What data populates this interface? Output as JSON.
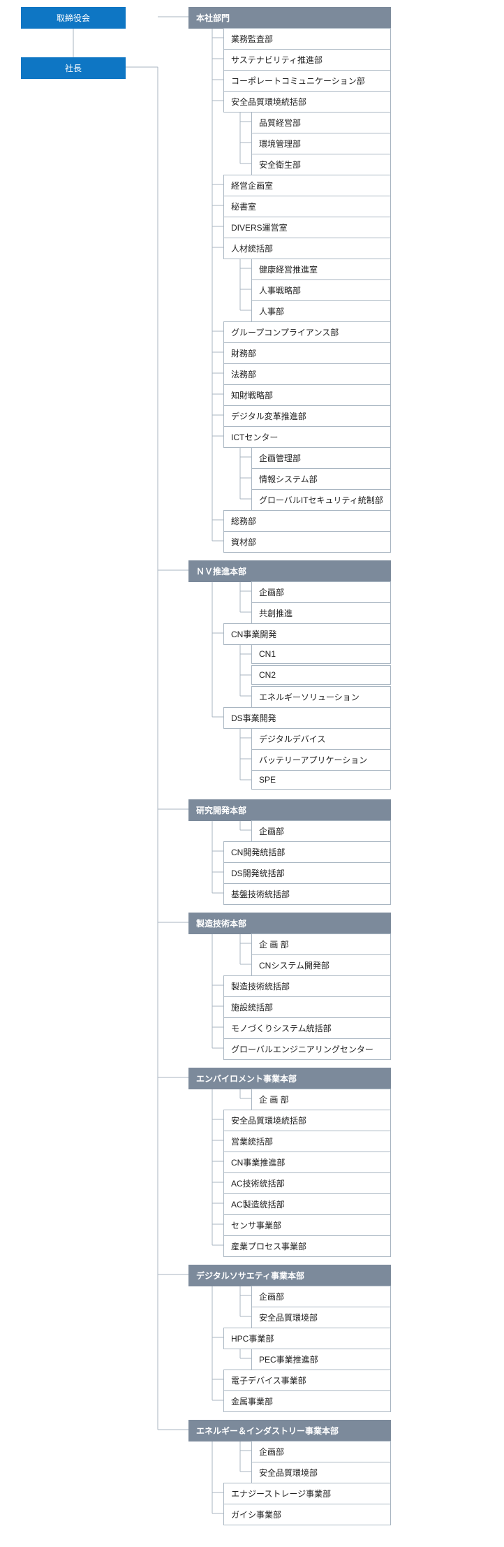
{
  "roots": {
    "board": "取締役会",
    "president": "社長"
  },
  "divisions": [
    {
      "name": "本社部門",
      "items": [
        {
          "label": "業務監査部"
        },
        {
          "label": "サステナビリティ推進部"
        },
        {
          "label": "コーポレートコミュニケーション部"
        },
        {
          "label": "安全品質環境統括部",
          "children": [
            "品質経営部",
            "環境管理部",
            "安全衛生部"
          ]
        },
        {
          "label": "経営企画室"
        },
        {
          "label": "秘書室"
        },
        {
          "label": "DIVERS運営室"
        },
        {
          "label": "人材統括部",
          "children": [
            "健康経営推進室",
            "人事戦略部",
            "人事部"
          ]
        },
        {
          "label": "グループコンプライアンス部"
        },
        {
          "label": "財務部"
        },
        {
          "label": "法務部"
        },
        {
          "label": "知財戦略部"
        },
        {
          "label": "デジタル変革推進部"
        },
        {
          "label": "ICTセンター",
          "children": [
            "企画管理部",
            "情報システム部",
            "グローバルITセキュリティ統制部"
          ]
        },
        {
          "label": "総務部"
        },
        {
          "label": "資材部"
        }
      ]
    },
    {
      "name": "ＮＶ推進本部",
      "items": [
        {
          "label": null,
          "children_direct": [
            "企画部",
            "共創推進"
          ]
        },
        {
          "label": "CN事業開発",
          "children": [
            "CN1",
            "CN2",
            "エネルギーソリューション"
          ]
        },
        {
          "label": "DS事業開発",
          "children": [
            "デジタルデバイス",
            "バッテリーアプリケーション",
            "SPE"
          ]
        }
      ]
    },
    {
      "name": "研究開発本部",
      "items": [
        {
          "label": null,
          "children_direct": [
            "企画部"
          ]
        },
        {
          "label": "CN開発統括部"
        },
        {
          "label": "DS開発統括部"
        },
        {
          "label": "基盤技術統括部"
        }
      ]
    },
    {
      "name": "製造技術本部",
      "items": [
        {
          "label": null,
          "children_direct": [
            "企 画 部",
            "CNシステム開発部"
          ]
        },
        {
          "label": "製造技術統括部"
        },
        {
          "label": "施設統括部"
        },
        {
          "label": "モノづくりシステム統括部"
        },
        {
          "label": "グローバルエンジニアリングセンター"
        }
      ]
    },
    {
      "name": "エンバイロメント事業本部",
      "items": [
        {
          "label": null,
          "children_direct": [
            "企 画 部"
          ]
        },
        {
          "label": "安全品質環境統括部"
        },
        {
          "label": "営業統括部"
        },
        {
          "label": "CN事業推進部"
        },
        {
          "label": "AC技術統括部"
        },
        {
          "label": "AC製造統括部"
        },
        {
          "label": "センサ事業部"
        },
        {
          "label": "産業プロセス事業部"
        }
      ]
    },
    {
      "name": "デジタルソサエティ事業本部",
      "items": [
        {
          "label": null,
          "children_direct": [
            "企画部",
            "安全品質環境部"
          ]
        },
        {
          "label": "HPC事業部",
          "children": [
            "PEC事業推進部"
          ]
        },
        {
          "label": "電子デバイス事業部"
        },
        {
          "label": "金属事業部"
        }
      ]
    },
    {
      "name": "エネルギー＆インダストリー事業本部",
      "items": [
        {
          "label": null,
          "children_direct": [
            "企画部",
            "安全品質環境部"
          ]
        },
        {
          "label": "エナジーストレージ事業部"
        },
        {
          "label": "ガイシ事業部"
        }
      ]
    }
  ]
}
